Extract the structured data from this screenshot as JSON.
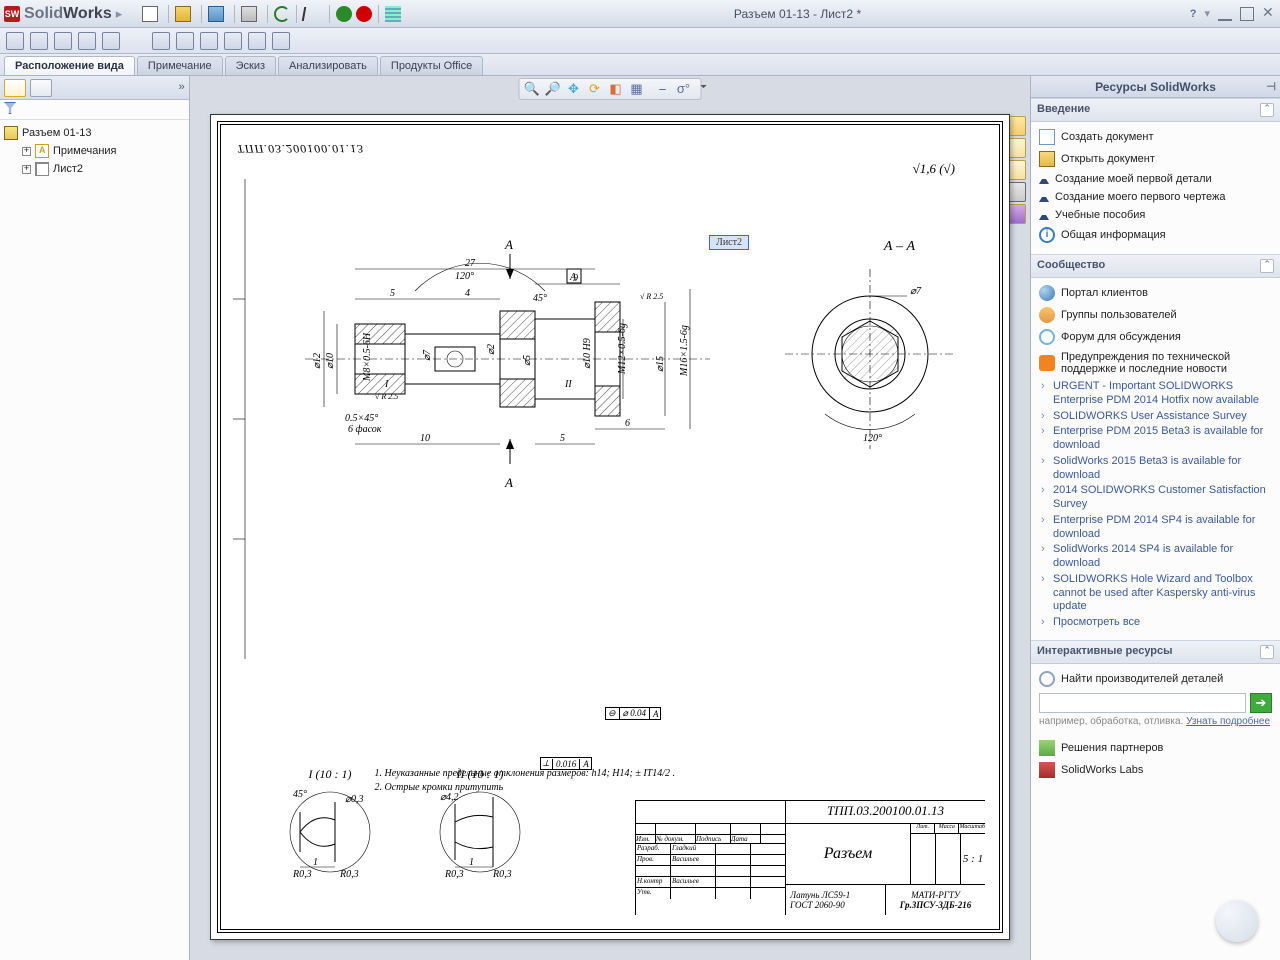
{
  "title": "Разъем 01-13 - Лист2 *",
  "logo": {
    "solid": "Solid",
    "works": "Works"
  },
  "qat_icons": [
    "new",
    "open",
    "save",
    "print",
    "undo",
    "cursor",
    "rebuild",
    "options"
  ],
  "tabs": [
    {
      "label": "Расположение вида",
      "active": true
    },
    {
      "label": "Примечание",
      "active": false
    },
    {
      "label": "Эскиз",
      "active": false
    },
    {
      "label": "Анализировать",
      "active": false
    },
    {
      "label": "Продукты Office",
      "active": false
    }
  ],
  "tree": {
    "root": "Разъем 01-13",
    "children": [
      {
        "label": "Примечания",
        "icon": "ann"
      },
      {
        "label": "Лист2",
        "icon": "sheet"
      }
    ]
  },
  "sheet_tag": "Лист2",
  "drawing": {
    "upside_code": "ТПП.03.200100.01.13",
    "surface_mark": "√1,6  (√)",
    "section_title": "А – А",
    "arrow_label": "А",
    "dim_27": "27",
    "dim_9": "9",
    "dim_5a": "5",
    "dim_4": "4",
    "dim_5b": "5",
    "dim_6": "6",
    "dim_10": "10",
    "dim_d2": "⌀2",
    "dim_d7": "⌀7",
    "dim_d5": "⌀5",
    "dim_d10": "⌀10",
    "dim_d12": "⌀12",
    "dim_d7a": "⌀7",
    "dim_d10h9": "⌀10 H9",
    "dim_d15": "⌀15",
    "thread_m12": "M12×0.5-6g",
    "thread_m16": "M16×1.5-6g",
    "thread_m8": "M8×0.5-6H",
    "ang_120": "120°",
    "ang_45": "45°",
    "chamfer": "0.5×45°",
    "chamfer_qty": "6 фасок",
    "flat1": "⌀ 0.04",
    "flat1_ref": "А",
    "flat2": "0.016",
    "flat2_ref": "А",
    "rgroove": "R 2.5",
    "detail_I": "I  (10 : 1)",
    "detail_II": "II  (10 : 1)",
    "d03": "R0,3",
    "dim_1": "1",
    "d42": "⌀4,2",
    "d03b": "⌀0,3",
    "notes": [
      "1. Неуказанные предельные отклонения размеров: h14; H14;  ± IT14/2 .",
      "2. Острые кромки притупить"
    ],
    "title_block": {
      "code": "ТПП.03.200100.01.13",
      "name": "Разъем",
      "scale": "5 : 1",
      "material": "Латунь  ЛС59-1",
      "material2": "ГОСТ  2060-90",
      "org": "МАТИ-РГТУ",
      "group": "Гр.3ПСУ-3ДБ-216",
      "dev": "Разраб.",
      "chk": "Пров.",
      "ncont": "Н.контр",
      "utv": "Утв.",
      "gladky": "Гладкий",
      "vasil": "Васильев",
      "col1": "Изм.",
      "col2": "№ докум.",
      "col3": "Подпись",
      "col4": "Дата",
      "litcol": "Лит.",
      "masscol": "Масса",
      "mcol": "Масштаб"
    }
  },
  "right": {
    "title": "Ресурсы SolidWorks",
    "sect1": "Введение",
    "sect1_items": [
      "Создать документ",
      "Открыть документ",
      "Создание моей первой детали",
      "Создание моего первого чертежа",
      "Учебные пособия",
      "Общая информация"
    ],
    "sect2": "Сообщество",
    "sect2_items": [
      "Портал клиентов",
      "Группы пользователей",
      "Форум для обсуждения",
      "Предупреждения по технической поддержке и последние новости"
    ],
    "news": [
      "URGENT - Important SOLIDWORKS Enterprise PDM 2014 Hotfix now available",
      "SOLIDWORKS User Assistance Survey",
      "Enterprise PDM 2015 Beta3 is available for download",
      "SolidWorks 2015 Beta3 is available for download",
      "2014 SOLIDWORKS Customer Satisfaction Survey",
      "Enterprise PDM 2014 SP4 is available for download",
      "SolidWorks 2014 SP4 is available for download",
      "SOLIDWORKS Hole Wizard and Toolbox cannot be used after Kaspersky anti-virus update"
    ],
    "news_all": "Просмотреть все",
    "sect3": "Интерактивные ресурсы",
    "search_label": "Найти производителей деталей",
    "search_hint": "например, обработка, отливка.",
    "search_more": "Узнать подробнее",
    "sect3_items": [
      "Решения партнеров",
      "SolidWorks Labs"
    ]
  }
}
